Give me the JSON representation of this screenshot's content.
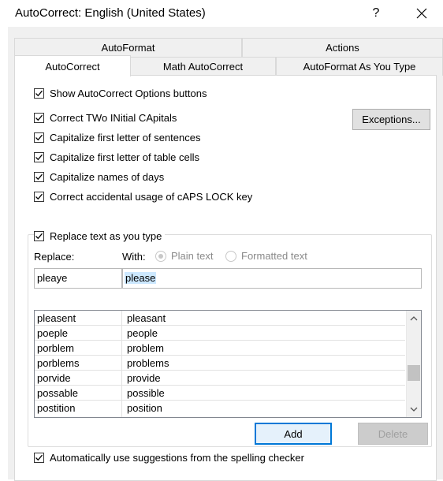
{
  "window": {
    "title": "AutoCorrect: English (United States)",
    "help_glyph": "?"
  },
  "tabs": {
    "autoformat": "AutoFormat",
    "actions": "Actions",
    "autocorrect": "AutoCorrect",
    "math_autocorrect": "Math AutoCorrect",
    "autoformat_as_you_type": "AutoFormat As You Type"
  },
  "options": {
    "show_buttons": "Show AutoCorrect Options buttons",
    "two_initial_capitals": "Correct TWo INitial CApitals",
    "capitalize_sentences": "Capitalize first letter of sentences",
    "capitalize_table_cells": "Capitalize first letter of table cells",
    "capitalize_days": "Capitalize names of days",
    "caps_lock": "Correct accidental usage of cAPS LOCK key",
    "exceptions_button": "Exceptions..."
  },
  "replace": {
    "checkbox_label": "Replace text as you type",
    "replace_label": "Replace:",
    "with_label": "With:",
    "plain_text": "Plain text",
    "formatted_text": "Formatted text",
    "replace_value": "pleaye",
    "with_value": "please",
    "list": [
      [
        "pleasent",
        "pleasant"
      ],
      [
        "poeple",
        "people"
      ],
      [
        "porblem",
        "problem"
      ],
      [
        "porblems",
        "problems"
      ],
      [
        "porvide",
        "provide"
      ],
      [
        "possable",
        "possible"
      ],
      [
        "postition",
        "position"
      ]
    ],
    "add_button": "Add",
    "delete_button": "Delete"
  },
  "spelling": {
    "label": "Automatically use suggestions from the spelling checker"
  }
}
